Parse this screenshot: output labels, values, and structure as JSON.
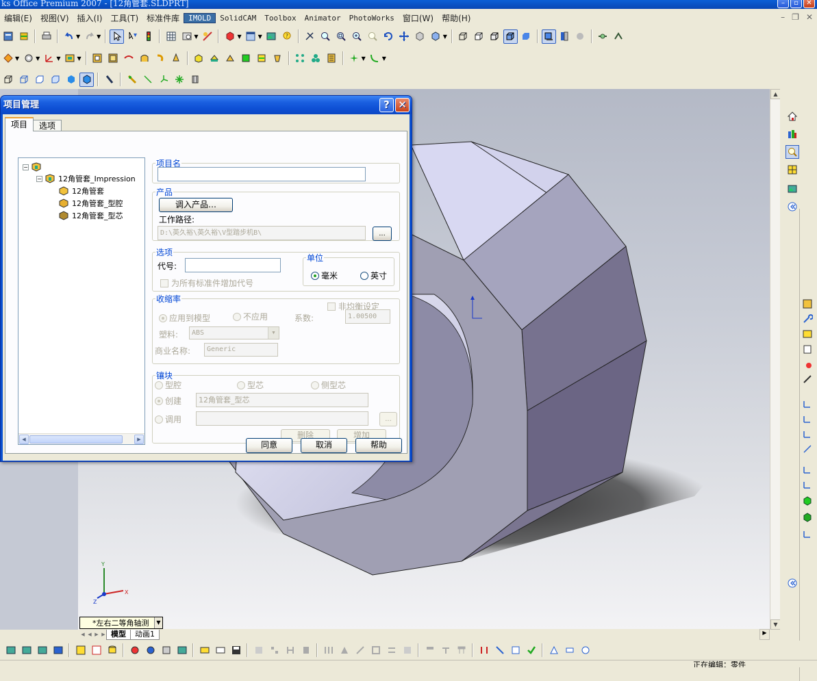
{
  "app": {
    "title": "ks Office Premium 2007 - [12角管套.SLDPRT]",
    "status": "正在编辑：零件"
  },
  "menu": [
    {
      "label": "编辑(E)",
      "active": false
    },
    {
      "label": "视图(V)",
      "active": false
    },
    {
      "label": "插入(I)",
      "active": false
    },
    {
      "label": "工具(T)",
      "active": false
    },
    {
      "label": "标准件库",
      "active": false
    },
    {
      "label": "IMOLD",
      "active": true
    },
    {
      "label": "SolidCAM",
      "active": false
    },
    {
      "label": "Toolbox",
      "active": false
    },
    {
      "label": "Animator",
      "active": false
    },
    {
      "label": "PhotoWorks",
      "active": false
    },
    {
      "label": "窗口(W)",
      "active": false
    },
    {
      "label": "帮助(H)",
      "active": false
    }
  ],
  "view": {
    "selector_label": "*左右二等角轴测",
    "tabs": [
      "模型",
      "动画1"
    ],
    "active_tab": "模型"
  },
  "dialog": {
    "title": "项目管理",
    "tabs": [
      "项目",
      "选项"
    ],
    "active_tab": "项目",
    "tree": {
      "root_label": "",
      "assembly_label": "12角管套_Impression",
      "children": [
        "12角管套",
        "12角管套_型腔",
        "12角管套_型芯"
      ]
    },
    "project_name": {
      "legend": "项目名",
      "value": ""
    },
    "product": {
      "legend": "产品",
      "load_button": "调入产品…",
      "path_label": "工作路径:",
      "path_value": "D:\\英久裕\\英久裕\\V型踏步机B\\",
      "browse_button": "..."
    },
    "options": {
      "legend": "选项",
      "code_label": "代号:",
      "code_value": "",
      "add_code_check": "为所有标准件增加代号",
      "add_code_checked": false,
      "units_legend": "单位",
      "unit_mm": "毫米",
      "unit_inch": "英寸",
      "selected_unit": "mm"
    },
    "shrinkage": {
      "legend": "收缩率",
      "nonuniform_check": "非均衡设定",
      "apply_to_model": "应用到模型",
      "not_apply": "不应用",
      "factor_label": "系数:",
      "factor_value": "1.00500",
      "material_label": "塑料:",
      "material_value": "ABS",
      "trade_name_label": "商业名称:",
      "trade_name_value": "Generic"
    },
    "insert": {
      "legend": "镶块",
      "cavity": "型腔",
      "core": "型芯",
      "side_core": "侧型芯",
      "create": "创建",
      "create_value": "12角管套_型芯",
      "call": "调用",
      "call_value": "",
      "browse_button": "...",
      "delete_button": "删除",
      "add_button": "增加"
    },
    "buttons": {
      "ok": "同意",
      "cancel": "取消",
      "help": "帮助"
    }
  },
  "colors": {
    "dialog_title_blue": "#0a50d0",
    "legend_blue": "#0046d5",
    "part_face_light": "#d6d6ee",
    "part_face_mid": "#9a98b0",
    "part_face_dark": "#6f6a8a"
  }
}
